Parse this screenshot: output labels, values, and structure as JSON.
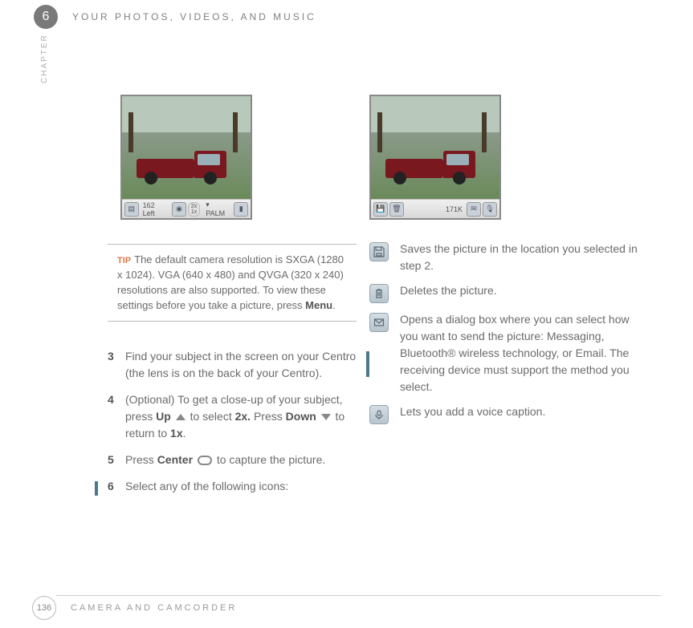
{
  "header": {
    "chapter_number": "6",
    "title": "YOUR PHOTOS, VIDEOS, AND MUSIC",
    "chapter_label": "CHAPTER"
  },
  "screenshots": {
    "left_status": {
      "count": "162 Left",
      "zoom_top": "2x",
      "zoom_bottom": "1x",
      "folder": "PALM"
    },
    "right_status": {
      "size": "171K"
    }
  },
  "tip": {
    "label": "TIP",
    "text_parts": {
      "a": "The default camera resolution is SXGA (1280 x 1024). VGA (640 x 480) and QVGA (320 x 240) resolutions are also supported. To view these settings before you take a picture, press ",
      "b": "Menu",
      "c": "."
    }
  },
  "steps": {
    "s3": {
      "num": "3",
      "text": "Find your subject in the screen on your Centro (the lens is on the back of your Centro)."
    },
    "s4": {
      "num": "4",
      "a": "(Optional)  To get a close-up of your subject, press ",
      "up": "Up",
      "b": " to select ",
      "twox": "2x.",
      "c": " Press ",
      "down": "Down",
      "d": " to return to ",
      "onex": "1x",
      "e": "."
    },
    "s5": {
      "num": "5",
      "a": "Press ",
      "center": "Center",
      "b": " to capture the picture."
    },
    "s6": {
      "num": "6",
      "text": "Select any of the following icons:"
    }
  },
  "icons": {
    "save": "Saves the picture in the location you selected in step 2.",
    "delete": "Deletes the picture.",
    "send": "Opens a dialog box where you can select how you want to send the picture: Messaging, Bluetooth® wireless technology, or Email. The receiving device must support the method you select.",
    "voice": "Lets you add a voice caption."
  },
  "footer": {
    "page": "136",
    "section": "CAMERA AND CAMCORDER"
  }
}
